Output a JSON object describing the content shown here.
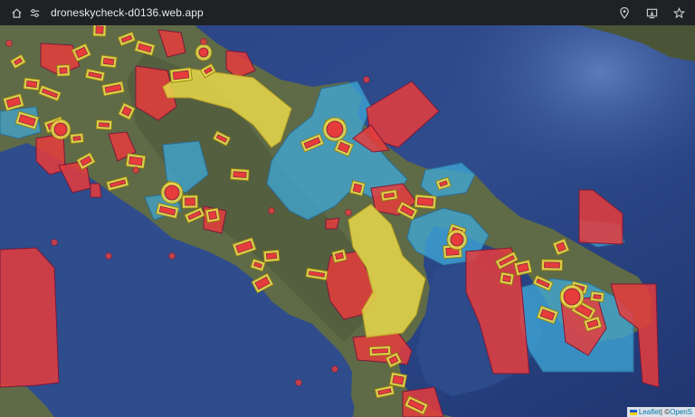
{
  "browser": {
    "url": "droneskycheck-d0136.web.app",
    "icons": [
      "home-icon",
      "site-settings-icon",
      "location-icon",
      "install-app-icon",
      "bookmark-star-icon"
    ]
  },
  "map": {
    "colors": {
      "sea_deep": "#1f3571",
      "sea_mid": "#2f4c8d",
      "sea_shallow": "#4a6aa8",
      "land": "#5f6b47",
      "land_dark": "#4a5538",
      "restricted_red": "#e63c3c",
      "caution_yellow": "#e8d84a",
      "controlled_blue": "#3fa9d9",
      "zone_border": "#7a1a3a"
    },
    "legend": "none"
  },
  "attribution": {
    "leaflet": "Leaflet",
    "separator": " | © ",
    "osm": "OpenS"
  }
}
